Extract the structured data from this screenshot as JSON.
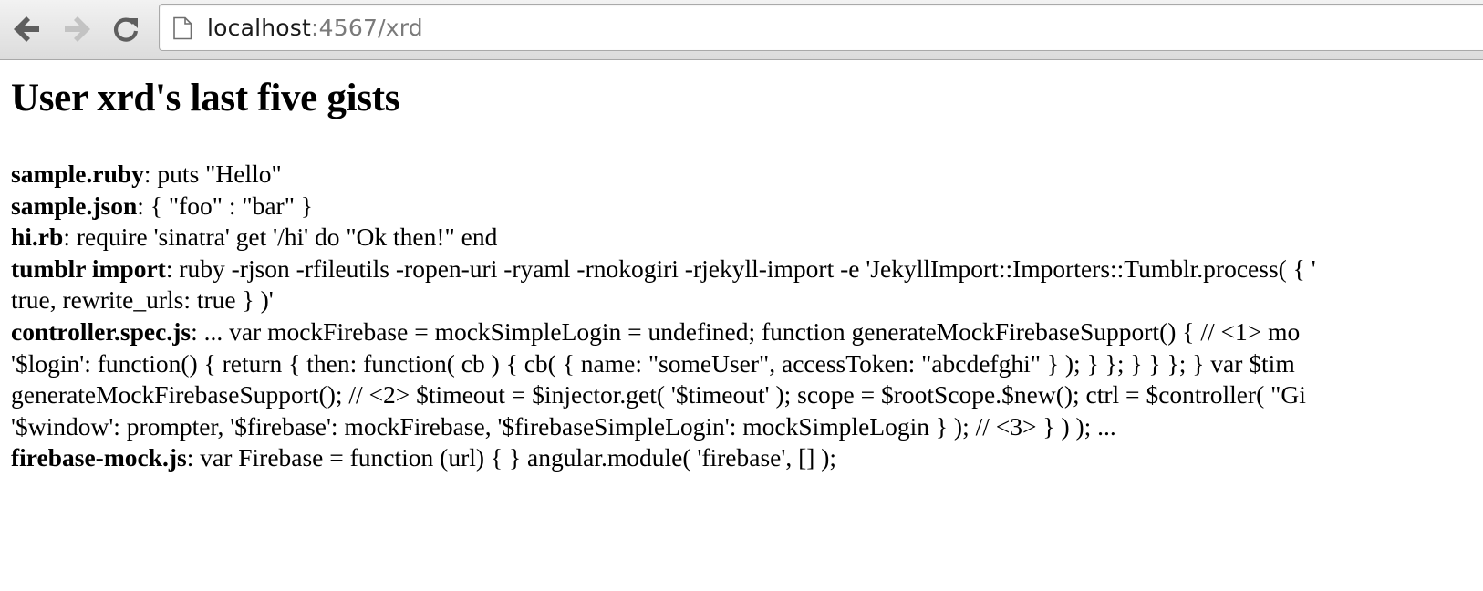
{
  "browser": {
    "address": {
      "host": "localhost",
      "rest": ":4567/xrd"
    }
  },
  "page": {
    "title": "User xrd's last five gists",
    "gists": [
      {
        "name": "sample.ruby",
        "lines": [
          ": puts \"Hello\""
        ]
      },
      {
        "name": "sample.json",
        "lines": [
          ": { \"foo\" : \"bar\" }"
        ]
      },
      {
        "name": "hi.rb",
        "lines": [
          ": require 'sinatra' get '/hi' do \"Ok then!\" end"
        ]
      },
      {
        "name": "tumblr import",
        "lines": [
          ": ruby -rjson -rfileutils -ropen-uri -ryaml -rnokogiri -rjekyll-import -e 'JekyllImport::Importers::Tumblr.process( { '",
          "true, rewrite_urls: true } )'"
        ]
      },
      {
        "name": "controller.spec.js",
        "lines": [
          ": ... var mockFirebase = mockSimpleLogin = undefined; function generateMockFirebaseSupport() { // <1> mo",
          "'$login': function() { return { then: function( cb ) { cb( { name: \"someUser\", accessToken: \"abcdefghi\" } ); } }; } } }; } var $tim",
          "generateMockFirebaseSupport(); // <2> $timeout = $injector.get( '$timeout' ); scope = $rootScope.$new(); ctrl = $controller( \"Gi",
          "'$window': prompter, '$firebase': mockFirebase, '$firebaseSimpleLogin': mockSimpleLogin } ); // <3> } ) ); ..."
        ]
      },
      {
        "name": "firebase-mock.js",
        "lines": [
          ": var Firebase = function (url) { } angular.module( 'firebase', [] );"
        ]
      }
    ]
  }
}
